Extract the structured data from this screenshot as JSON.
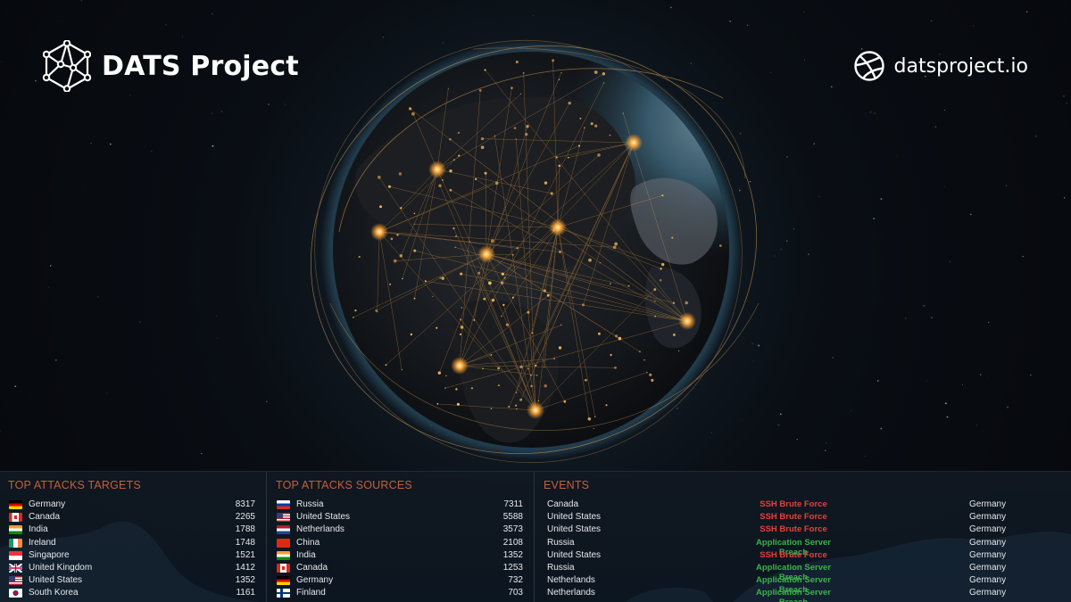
{
  "header": {
    "brand": "DATS Project",
    "site": "datsproject.io"
  },
  "colors": {
    "accent_title": "#c2603a",
    "event_red": "#e3413a",
    "event_green": "#3bb24a",
    "city_light": "#ffb347"
  },
  "icons": {
    "brand": "network-polyhedron-icon",
    "site": "basketball-globe-icon"
  },
  "targets": {
    "title": "TOP ATTACKS TARGETS",
    "rows": [
      {
        "country": "Germany",
        "count": "8317",
        "flag": "de"
      },
      {
        "country": "Canada",
        "count": "2265",
        "flag": "ca"
      },
      {
        "country": "India",
        "count": "1788",
        "flag": "in"
      },
      {
        "country": "Ireland",
        "count": "1748",
        "flag": "ie"
      },
      {
        "country": "Singapore",
        "count": "1521",
        "flag": "sg"
      },
      {
        "country": "United Kingdom",
        "count": "1412",
        "flag": "gb"
      },
      {
        "country": "United States",
        "count": "1352",
        "flag": "us"
      },
      {
        "country": "South Korea",
        "count": "1161",
        "flag": "kr"
      }
    ]
  },
  "sources": {
    "title": "TOP ATTACKS SOURCES",
    "rows": [
      {
        "country": "Russia",
        "count": "7311",
        "flag": "ru"
      },
      {
        "country": "United States",
        "count": "5588",
        "flag": "us"
      },
      {
        "country": "Netherlands",
        "count": "3573",
        "flag": "nl"
      },
      {
        "country": "China",
        "count": "2108",
        "flag": "cn"
      },
      {
        "country": "India",
        "count": "1352",
        "flag": "in"
      },
      {
        "country": "Canada",
        "count": "1253",
        "flag": "ca"
      },
      {
        "country": "Germany",
        "count": "732",
        "flag": "de"
      },
      {
        "country": "Finland",
        "count": "703",
        "flag": "fi"
      }
    ]
  },
  "events": {
    "title": "EVENTS",
    "rows": [
      {
        "source": "Canada",
        "type": "SSH Brute Force",
        "severity": "red",
        "target": "Germany"
      },
      {
        "source": "United States",
        "type": "SSH Brute Force",
        "severity": "red",
        "target": "Germany"
      },
      {
        "source": "United States",
        "type": "SSH Brute Force",
        "severity": "red",
        "target": "Germany"
      },
      {
        "source": "Russia",
        "type": "Application Server Breach",
        "severity": "green",
        "target": "Germany"
      },
      {
        "source": "United States",
        "type": "SSH Brute Force",
        "severity": "red",
        "target": "Germany"
      },
      {
        "source": "Russia",
        "type": "Application Server Breach",
        "severity": "green",
        "target": "Germany"
      },
      {
        "source": "Netherlands",
        "type": "Application Server Breach",
        "severity": "green",
        "target": "Germany"
      },
      {
        "source": "Netherlands",
        "type": "Application Server Breach",
        "severity": "green",
        "target": "Germany"
      }
    ]
  }
}
